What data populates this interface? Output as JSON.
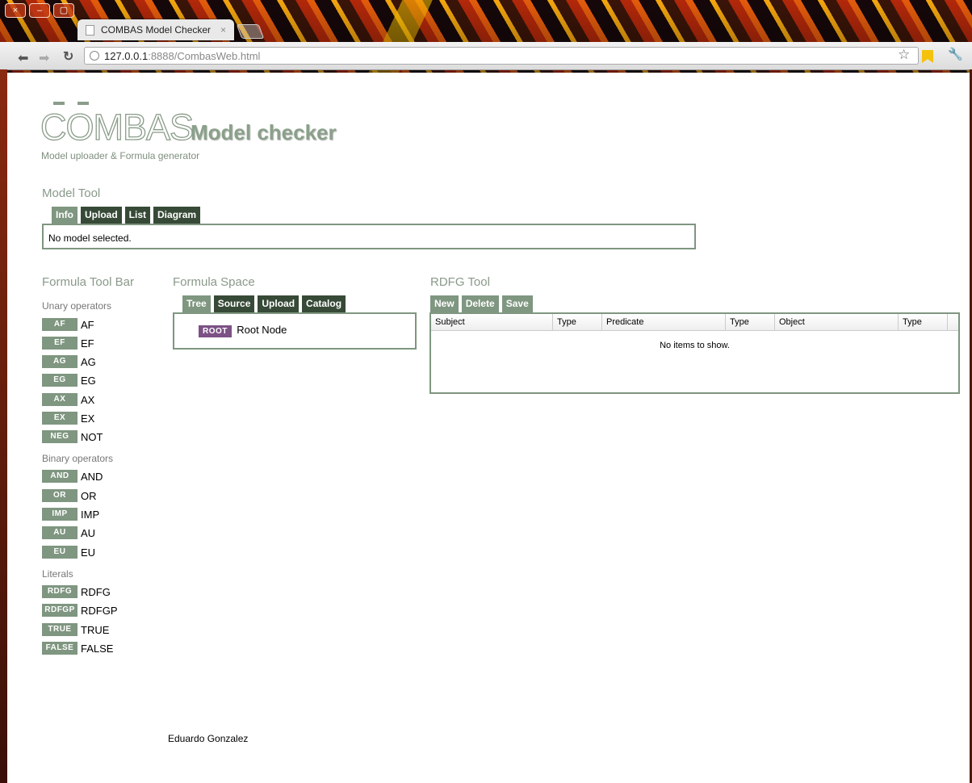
{
  "browser": {
    "tab_title": "COMBAS Model Checker",
    "tab_close": "×",
    "url_host": "127.0.0.1",
    "url_path": ":8888/CombasWeb.html",
    "window_buttons": [
      "×",
      "–",
      "▢"
    ]
  },
  "header": {
    "logo_text": "COMBAS",
    "title": "Model checker",
    "subtitle": "Model uploader & Formula generator"
  },
  "model_tool": {
    "heading": "Model Tool",
    "tabs": [
      "Info",
      "Upload",
      "List",
      "Diagram"
    ],
    "active_tab": "Info",
    "content": "No model selected."
  },
  "formula_toolbar": {
    "heading": "Formula Tool Bar",
    "groups": [
      {
        "label": "Unary operators",
        "items": [
          {
            "badge": "AF",
            "label": "AF"
          },
          {
            "badge": "EF",
            "label": "EF"
          },
          {
            "badge": "AG",
            "label": "AG"
          },
          {
            "badge": "EG",
            "label": "EG"
          },
          {
            "badge": "AX",
            "label": "AX"
          },
          {
            "badge": "EX",
            "label": "EX"
          },
          {
            "badge": "NEG",
            "label": "NOT"
          }
        ]
      },
      {
        "label": "Binary operators",
        "items": [
          {
            "badge": "AND",
            "label": "AND"
          },
          {
            "badge": "OR",
            "label": "OR"
          },
          {
            "badge": "IMP",
            "label": "IMP"
          },
          {
            "badge": "AU",
            "label": "AU"
          },
          {
            "badge": "EU",
            "label": "EU"
          }
        ]
      },
      {
        "label": "Literals",
        "items": [
          {
            "badge": "RDFG",
            "label": "RDFG"
          },
          {
            "badge": "RDFGP",
            "label": "RDFGP"
          },
          {
            "badge": "TRUE",
            "label": "TRUE"
          },
          {
            "badge": "FALSE",
            "label": "FALSE"
          }
        ]
      }
    ]
  },
  "formula_space": {
    "heading": "Formula Space",
    "tabs": [
      "Tree",
      "Source",
      "Upload",
      "Catalog"
    ],
    "active_tab": "Tree",
    "root_badge": "ROOT",
    "root_label": "Root Node"
  },
  "rdfg_tool": {
    "heading": "RDFG Tool",
    "buttons": [
      "New",
      "Delete",
      "Save"
    ],
    "columns": [
      "Subject",
      "Type",
      "Predicate",
      "Type",
      "Object",
      "Type"
    ],
    "empty_text": "No items to show."
  },
  "footer": {
    "author": "Eduardo Gonzalez"
  },
  "colors": {
    "accent": "#7f9680",
    "tab_dark": "#374a37",
    "root_badge": "#7c5185"
  }
}
